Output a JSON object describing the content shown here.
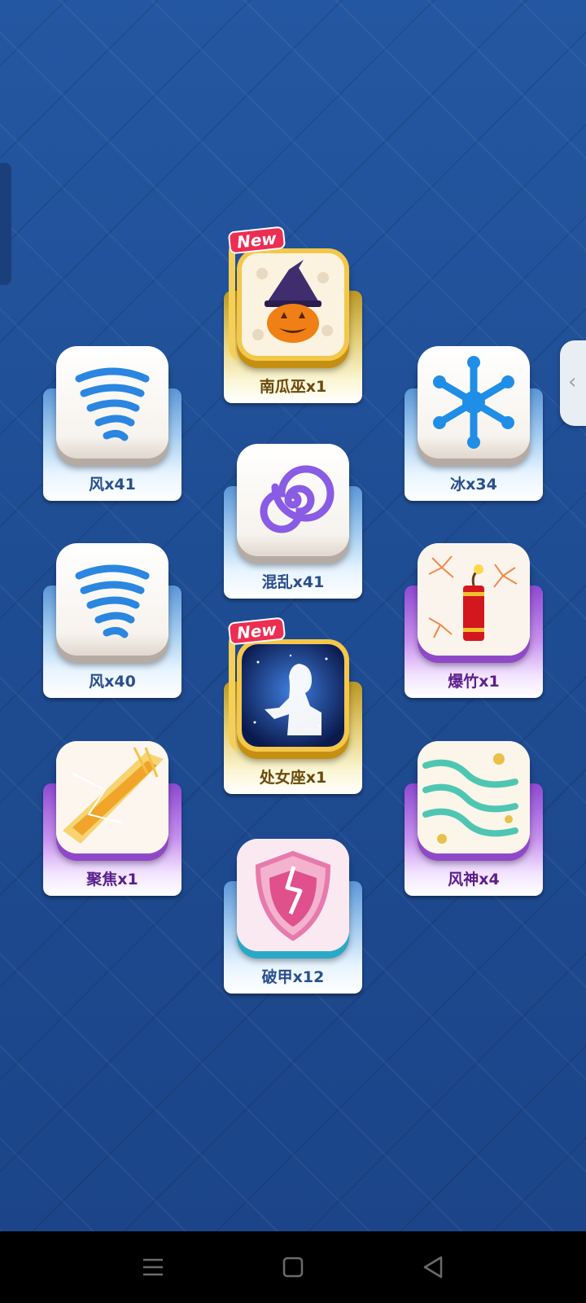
{
  "new_badge_text": "New",
  "items": [
    {
      "label": "南瓜巫x1",
      "icon": "pumpkin-witch-icon",
      "is_new": true
    },
    {
      "label": "风x41",
      "icon": "tornado-icon"
    },
    {
      "label": "冰x34",
      "icon": "snowflake-icon"
    },
    {
      "label": "混乱x41",
      "icon": "spiral-icon"
    },
    {
      "label": "风x40",
      "icon": "tornado-icon"
    },
    {
      "label": "爆竹x1",
      "icon": "firecracker-icon"
    },
    {
      "label": "处女座x1",
      "icon": "virgo-silhouette-icon",
      "is_new": true
    },
    {
      "label": "聚焦x1",
      "icon": "focus-beam-icon"
    },
    {
      "label": "风神x4",
      "icon": "wind-god-swirl-icon"
    },
    {
      "label": "破甲x12",
      "icon": "broken-shield-icon"
    }
  ],
  "navbar": {
    "menu_icon": "menu-icon",
    "home_icon": "home-square-icon",
    "back_icon": "back-triangle-icon"
  }
}
